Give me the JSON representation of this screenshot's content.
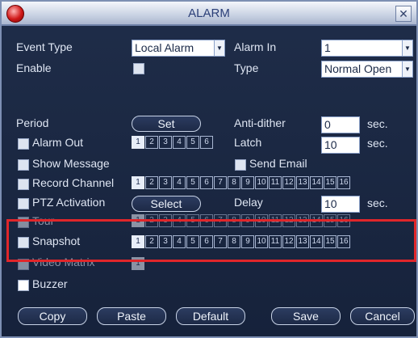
{
  "window": {
    "title": "ALARM",
    "close_label": "✕"
  },
  "event_type": {
    "label": "Event Type",
    "value": "Local Alarm"
  },
  "alarm_in": {
    "label": "Alarm In",
    "value": "1"
  },
  "enable": {
    "label": "Enable",
    "checked": false
  },
  "type": {
    "label": "Type",
    "value": "Normal Open"
  },
  "period": {
    "label": "Period",
    "button": "Set"
  },
  "anti_dither": {
    "label": "Anti-dither",
    "value": "0",
    "unit": "sec."
  },
  "alarm_out": {
    "label": "Alarm Out",
    "channels": [
      "1",
      "2",
      "3",
      "4",
      "5",
      "6"
    ],
    "selected": [
      "1"
    ]
  },
  "latch": {
    "label": "Latch",
    "value": "10",
    "unit": "sec."
  },
  "show_message": {
    "label": "Show Message"
  },
  "send_email": {
    "label": "Send Email"
  },
  "record_channel": {
    "label": "Record Channel",
    "channels": [
      "1",
      "2",
      "3",
      "4",
      "5",
      "6",
      "7",
      "8",
      "9",
      "10",
      "11",
      "12",
      "13",
      "14",
      "15",
      "16"
    ],
    "selected": [
      "1"
    ]
  },
  "ptz_activation": {
    "label": "PTZ Activation",
    "button": "Select"
  },
  "delay": {
    "label": "Delay",
    "value": "10",
    "unit": "sec."
  },
  "tour": {
    "label": "Tour",
    "channels": [
      "1",
      "2",
      "3",
      "4",
      "5",
      "6",
      "7",
      "8",
      "9",
      "10",
      "11",
      "12",
      "13",
      "14",
      "15",
      "16"
    ],
    "selected": [
      "1"
    ]
  },
  "snapshot": {
    "label": "Snapshot",
    "channels": [
      "1",
      "2",
      "3",
      "4",
      "5",
      "6",
      "7",
      "8",
      "9",
      "10",
      "11",
      "12",
      "13",
      "14",
      "15",
      "16"
    ],
    "selected": [
      "1"
    ]
  },
  "video_matrix": {
    "label": "Video Matrix",
    "channels": [
      "1"
    ],
    "selected": [
      "1"
    ]
  },
  "buzzer": {
    "label": "Buzzer",
    "checked": true
  },
  "footer": {
    "copy": "Copy",
    "paste": "Paste",
    "default": "Default",
    "save": "Save",
    "cancel": "Cancel"
  },
  "colors": {
    "background": "#1f2d49",
    "title_text": "#2b3f78",
    "highlight": "#e0262a"
  }
}
